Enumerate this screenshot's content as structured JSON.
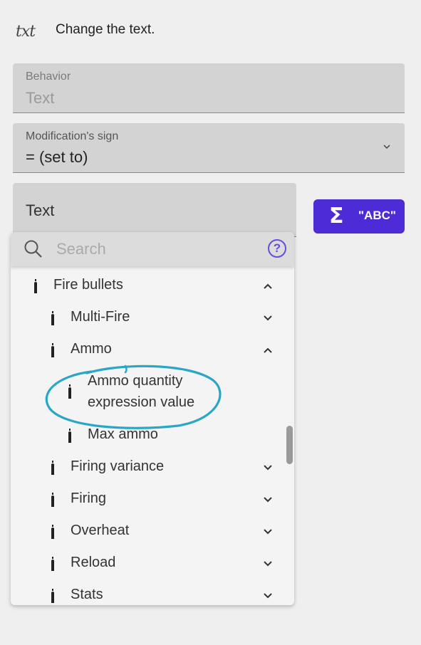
{
  "header": {
    "icon": "txt-icon",
    "icon_text": "txt",
    "text": "Change the text."
  },
  "behavior": {
    "label": "Behavior",
    "value": "Text"
  },
  "modification": {
    "label": "Modification's sign",
    "value": "= (set to)"
  },
  "text_field": {
    "value": "Text"
  },
  "abc_button": {
    "sigma": "Σ",
    "label": "\"ABC\""
  },
  "search": {
    "placeholder": "Search",
    "help": "?"
  },
  "tree": {
    "items": [
      {
        "label": "Fire bullets",
        "level": 0,
        "expanded": true
      },
      {
        "label": "Multi-Fire",
        "level": 1,
        "expanded": false
      },
      {
        "label": "Ammo",
        "level": 1,
        "expanded": true
      },
      {
        "label": "Ammo quantity",
        "label2": "expression value",
        "level": 2,
        "highlighted": true
      },
      {
        "label": "Max ammo",
        "level": 2
      },
      {
        "label": "Firing variance",
        "level": 1,
        "expanded": false
      },
      {
        "label": "Firing",
        "level": 1,
        "expanded": false
      },
      {
        "label": "Overheat",
        "level": 1,
        "expanded": false
      },
      {
        "label": "Reload",
        "level": 1,
        "expanded": false
      },
      {
        "label": "Stats",
        "level": 1,
        "expanded": false
      }
    ]
  },
  "colors": {
    "accent": "#4d2bd6",
    "highlight_circle": "#2aa6c6",
    "help_icon": "#6a4be0"
  }
}
